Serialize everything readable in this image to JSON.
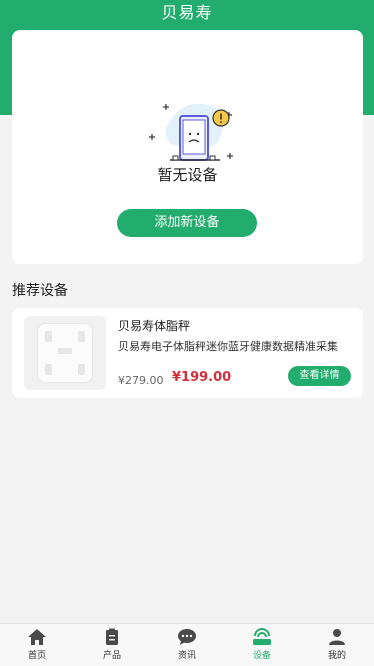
{
  "app": {
    "title": "贝易寿"
  },
  "empty": {
    "message": "暂无设备",
    "add_button": "添加新设备"
  },
  "recommend": {
    "title": "推荐设备",
    "product": {
      "name": "贝易寿体脂秤",
      "description": "贝易寿电子体脂秤迷你蓝牙健康数据精准采集",
      "original_price": "¥279.00",
      "price": "¥199.00",
      "detail_button": "查看详情"
    }
  },
  "tabbar": {
    "items": [
      {
        "label": "首页",
        "icon": "home-icon"
      },
      {
        "label": "产品",
        "icon": "clipboard-icon"
      },
      {
        "label": "资讯",
        "icon": "chat-icon"
      },
      {
        "label": "设备",
        "icon": "device-icon"
      },
      {
        "label": "我的",
        "icon": "user-icon"
      }
    ],
    "active": "设备"
  },
  "colors": {
    "primary": "#22ad6e",
    "price": "#d2303a"
  }
}
